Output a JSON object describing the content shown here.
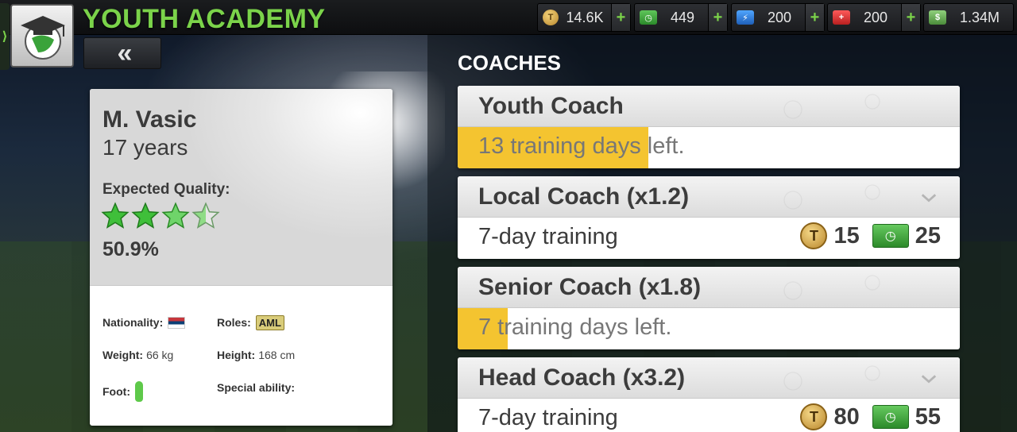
{
  "header": {
    "title": "YOUTH ACADEMY",
    "back_label": "«",
    "side_tab_glyph": "⟩"
  },
  "resources": [
    {
      "name": "tokens",
      "icon": "token-icon",
      "value": "14.6K",
      "glyph": "T"
    },
    {
      "name": "cash",
      "icon": "cash-icon",
      "value": "449",
      "glyph": "◷"
    },
    {
      "name": "energy",
      "icon": "energy-icon",
      "value": "200",
      "glyph": "⚡"
    },
    {
      "name": "medic",
      "icon": "medic-icon",
      "value": "200",
      "glyph": "+"
    },
    {
      "name": "money",
      "icon": "money-icon",
      "value": "1.34M",
      "glyph": "$"
    }
  ],
  "resource_plus": "+",
  "player": {
    "name": "M. Vasic",
    "age": "17 years",
    "expected_quality_label": "Expected Quality:",
    "stars_rating": 3.5,
    "stars_max": 4,
    "quality_percent": "50.9%",
    "nationality_label": "Nationality:",
    "nationality_flag": "serbia-flag",
    "roles_label": "Roles:",
    "role": "AML",
    "weight_label": "Weight:",
    "weight_value": "66 kg",
    "height_label": "Height:",
    "height_value": "168 cm",
    "foot_label": "Foot:",
    "special_ability_label": "Special ability:"
  },
  "coaches": {
    "heading": "COACHES",
    "items": [
      {
        "name": "Youth Coach",
        "status": "13 training days left.",
        "progress": 0.38,
        "expanded": false
      },
      {
        "name": "Local Coach (x1.2)",
        "training": "7-day training",
        "token_cost": "15",
        "cash_cost": "25",
        "expanded": true
      },
      {
        "name": "Senior Coach (x1.8)",
        "status": "7 training days left.",
        "progress": 0.1,
        "expanded": false
      },
      {
        "name": "Head Coach (x3.2)",
        "training": "7-day training",
        "token_cost": "80",
        "cash_cost": "55",
        "expanded": true
      }
    ]
  },
  "colors": {
    "accent_green": "#7bd34a",
    "progress_yellow": "#f4c430",
    "star_green": "#3fbf3a"
  }
}
